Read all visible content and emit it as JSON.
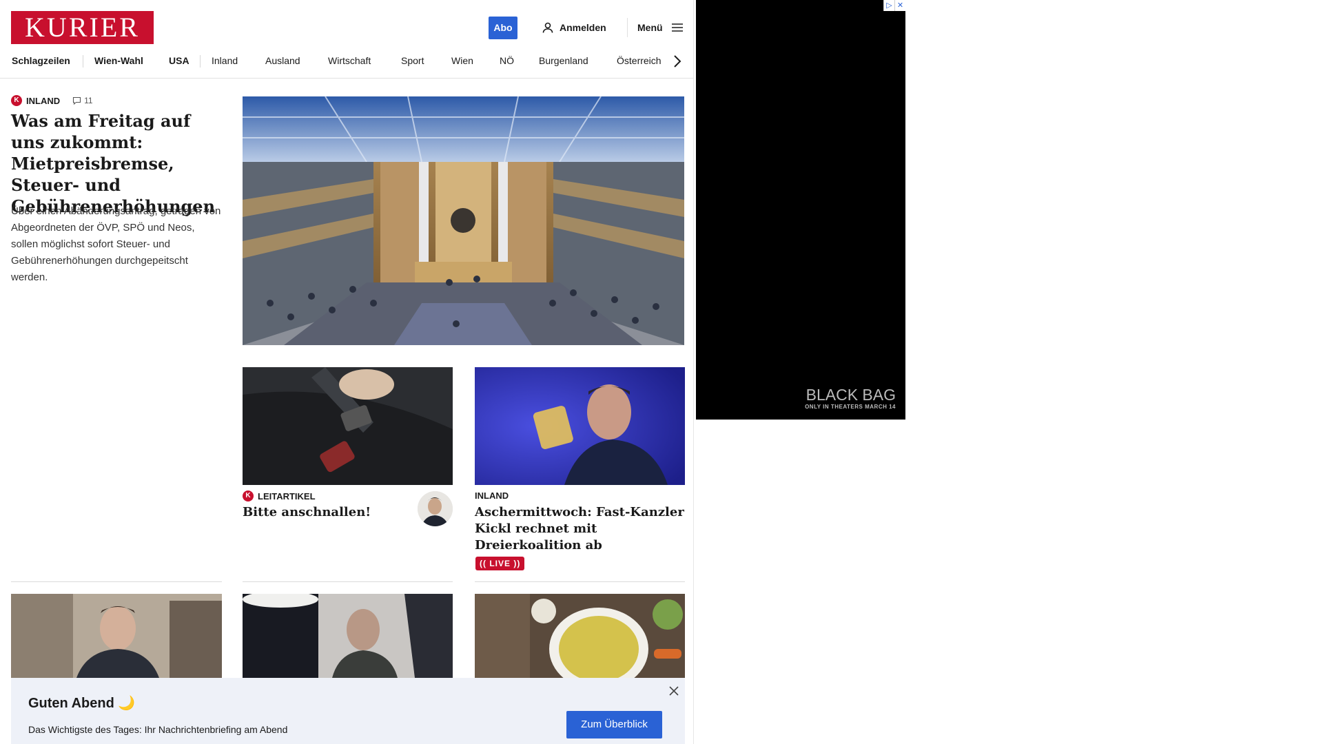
{
  "header": {
    "logo": "KURIER",
    "abo_label": "Abo",
    "login_label": "Anmelden",
    "menu_label": "Menü"
  },
  "nav": {
    "items": [
      "Schlagzeilen",
      "Wien-Wahl",
      "USA",
      "Inland",
      "Ausland",
      "Wirtschaft",
      "Sport",
      "Wien",
      "NÖ",
      "Burgenland",
      "Österreich"
    ]
  },
  "lead": {
    "badge": "K",
    "section": "INLAND",
    "comments": "11",
    "title": "Was am Freitag auf uns zukommt: Mietpreisbremse, Steuer- und Gebührenerhöhungen",
    "teaser": "Über einen Abänderungsantrag, getragen von Abgeordneten der ÖVP, SPÖ und Neos, sollen möglichst sofort Steuer- und Gebührenerhöhungen durchgepeitscht werden."
  },
  "cards": [
    {
      "badge": "K",
      "section": "LEITARTIKEL",
      "title": "Bitte anschnallen!"
    },
    {
      "section": "INLAND",
      "title": "Aschermittwoch: Fast-Kanzler Kickl rechnet mit Dreierkoalition ab",
      "live": "(( LIVE ))"
    }
  ],
  "briefing": {
    "title": "Guten Abend 🌙",
    "text": "Das Wichtigste des Tages: Ihr Nachrichtenbriefing am Abend",
    "button": "Zum Überblick"
  },
  "ad": {
    "title": "BLACK BAG",
    "subtitle": "ONLY IN THEATERS MARCH 14",
    "badge_info": "▷",
    "badge_close": "✕"
  },
  "colors": {
    "brand": "#c8102e",
    "accent": "#2a62d5"
  }
}
